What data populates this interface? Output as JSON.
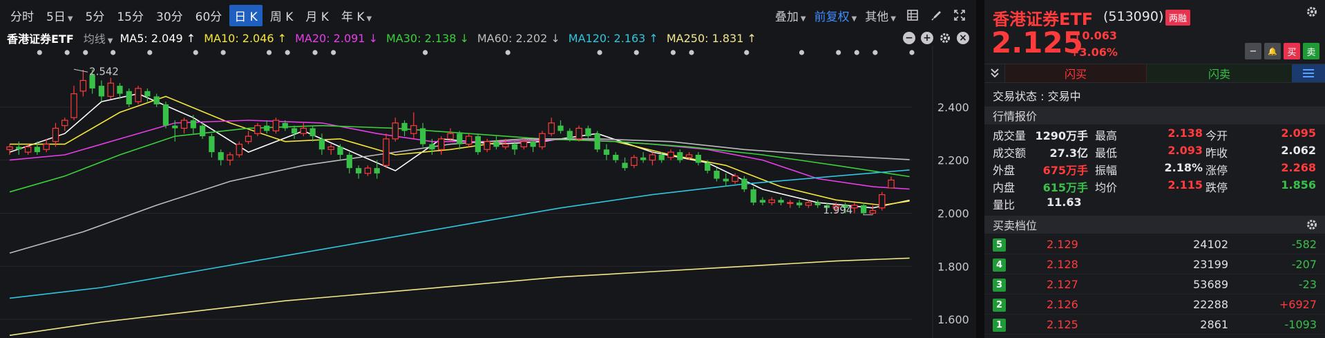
{
  "toolbar": {
    "periods": [
      "分时",
      "5日",
      "5分",
      "15分",
      "30分",
      "60分",
      "日 K",
      "周 K",
      "月 K",
      "年 K"
    ],
    "active_period": "日 K",
    "overlay_label": "叠加",
    "adjust_label": "前复权",
    "other_label": "其他"
  },
  "ma_row": {
    "name": "香港证券ETF",
    "mode": "均线",
    "items": [
      {
        "text": "MA5: 2.049 ↑",
        "color": "#ffffff"
      },
      {
        "text": "MA10: 2.046 ↑",
        "color": "#f5e63a"
      },
      {
        "text": "MA20: 2.091 ↓",
        "color": "#e83ee8"
      },
      {
        "text": "MA30: 2.138 ↓",
        "color": "#3ad13a"
      },
      {
        "text": "MA60: 2.202 ↓",
        "color": "#bdbdbd"
      },
      {
        "text": "MA120: 2.163 ↑",
        "color": "#2fc6e0"
      },
      {
        "text": "MA250: 1.831 ↑",
        "color": "#f2e68a"
      }
    ],
    "minus": "−",
    "plus": "+",
    "close": "×"
  },
  "chart_data": {
    "type": "candlestick",
    "y_ticks": [
      "2.400",
      "2.200",
      "2.000",
      "1.800",
      "1.600"
    ],
    "ylim": [
      1.53,
      2.6
    ],
    "annotations": [
      {
        "text": "2.542",
        "value": 2.542,
        "index": 7
      },
      {
        "text": "1.994",
        "value": 1.994,
        "index": 94
      }
    ],
    "candles": [
      [
        2.24,
        2.25,
        2.26,
        2.22
      ],
      [
        2.25,
        2.24,
        2.27,
        2.22
      ],
      [
        2.23,
        2.25,
        2.26,
        2.22
      ],
      [
        2.25,
        2.23,
        2.27,
        2.22
      ],
      [
        2.24,
        2.26,
        2.28,
        2.23
      ],
      [
        2.27,
        2.32,
        2.34,
        2.25
      ],
      [
        2.33,
        2.35,
        2.36,
        2.31
      ],
      [
        2.36,
        2.45,
        2.48,
        2.35
      ],
      [
        2.46,
        2.5,
        2.54,
        2.44
      ],
      [
        2.52,
        2.47,
        2.542,
        2.45
      ],
      [
        2.48,
        2.44,
        2.5,
        2.42
      ],
      [
        2.44,
        2.49,
        2.51,
        2.43
      ],
      [
        2.48,
        2.45,
        2.49,
        2.43
      ],
      [
        2.46,
        2.41,
        2.47,
        2.4
      ],
      [
        2.42,
        2.47,
        2.48,
        2.41
      ],
      [
        2.46,
        2.44,
        2.47,
        2.42
      ],
      [
        2.44,
        2.41,
        2.45,
        2.4
      ],
      [
        2.41,
        2.33,
        2.42,
        2.32
      ],
      [
        2.33,
        2.32,
        2.35,
        2.27
      ],
      [
        2.32,
        2.35,
        2.36,
        2.3
      ],
      [
        2.35,
        2.32,
        2.37,
        2.3
      ],
      [
        2.33,
        2.29,
        2.34,
        2.28
      ],
      [
        2.29,
        2.23,
        2.3,
        2.21
      ],
      [
        2.23,
        2.2,
        2.24,
        2.18
      ],
      [
        2.2,
        2.22,
        2.23,
        2.18
      ],
      [
        2.22,
        2.26,
        2.27,
        2.21
      ],
      [
        2.27,
        2.29,
        2.31,
        2.26
      ],
      [
        2.3,
        2.33,
        2.34,
        2.29
      ],
      [
        2.33,
        2.31,
        2.35,
        2.3
      ],
      [
        2.31,
        2.35,
        2.36,
        2.3
      ],
      [
        2.34,
        2.32,
        2.35,
        2.31
      ],
      [
        2.32,
        2.3,
        2.33,
        2.28
      ],
      [
        2.3,
        2.32,
        2.34,
        2.29
      ],
      [
        2.32,
        2.29,
        2.33,
        2.27
      ],
      [
        2.28,
        2.24,
        2.3,
        2.22
      ],
      [
        2.24,
        2.25,
        2.26,
        2.22
      ],
      [
        2.25,
        2.22,
        2.26,
        2.2
      ],
      [
        2.22,
        2.17,
        2.23,
        2.15
      ],
      [
        2.17,
        2.15,
        2.18,
        2.13
      ],
      [
        2.15,
        2.17,
        2.18,
        2.14
      ],
      [
        2.17,
        2.15,
        2.2,
        2.13
      ],
      [
        2.18,
        2.28,
        2.3,
        2.17
      ],
      [
        2.28,
        2.34,
        2.36,
        2.27
      ],
      [
        2.34,
        2.31,
        2.35,
        2.29
      ],
      [
        2.3,
        2.33,
        2.38,
        2.28
      ],
      [
        2.32,
        2.26,
        2.34,
        2.25
      ],
      [
        2.26,
        2.24,
        2.28,
        2.22
      ],
      [
        2.24,
        2.28,
        2.29,
        2.22
      ],
      [
        2.28,
        2.3,
        2.32,
        2.27
      ],
      [
        2.3,
        2.26,
        2.31,
        2.24
      ],
      [
        2.26,
        2.29,
        2.3,
        2.25
      ],
      [
        2.29,
        2.23,
        2.3,
        2.22
      ],
      [
        2.24,
        2.27,
        2.28,
        2.23
      ],
      [
        2.27,
        2.25,
        2.29,
        2.24
      ],
      [
        2.25,
        2.26,
        2.28,
        2.24
      ],
      [
        2.26,
        2.24,
        2.27,
        2.22
      ],
      [
        2.25,
        2.27,
        2.28,
        2.24
      ],
      [
        2.27,
        2.25,
        2.28,
        2.23
      ],
      [
        2.25,
        2.3,
        2.31,
        2.24
      ],
      [
        2.3,
        2.34,
        2.36,
        2.29
      ],
      [
        2.33,
        2.31,
        2.35,
        2.3
      ],
      [
        2.31,
        2.28,
        2.32,
        2.27
      ],
      [
        2.28,
        2.32,
        2.33,
        2.27
      ],
      [
        2.32,
        2.29,
        2.33,
        2.28
      ],
      [
        2.3,
        2.24,
        2.31,
        2.23
      ],
      [
        2.24,
        2.22,
        2.26,
        2.2
      ],
      [
        2.22,
        2.2,
        2.23,
        2.19
      ],
      [
        2.19,
        2.17,
        2.21,
        2.16
      ],
      [
        2.18,
        2.21,
        2.22,
        2.17
      ],
      [
        2.21,
        2.2,
        2.23,
        2.19
      ],
      [
        2.2,
        2.22,
        2.23,
        2.18
      ],
      [
        2.22,
        2.2,
        2.23,
        2.19
      ],
      [
        2.21,
        2.23,
        2.24,
        2.2
      ],
      [
        2.23,
        2.2,
        2.24,
        2.19
      ],
      [
        2.21,
        2.22,
        2.23,
        2.2
      ],
      [
        2.22,
        2.19,
        2.23,
        2.18
      ],
      [
        2.19,
        2.16,
        2.2,
        2.15
      ],
      [
        2.16,
        2.13,
        2.17,
        2.12
      ],
      [
        2.13,
        2.12,
        2.15,
        2.1
      ],
      [
        2.12,
        2.14,
        2.15,
        2.11
      ],
      [
        2.13,
        2.09,
        2.14,
        2.08
      ],
      [
        2.09,
        2.04,
        2.1,
        2.03
      ],
      [
        2.05,
        2.04,
        2.06,
        2.03
      ],
      [
        2.04,
        2.05,
        2.06,
        2.03
      ],
      [
        2.05,
        2.04,
        2.06,
        2.03
      ],
      [
        2.04,
        2.04,
        2.05,
        2.02
      ],
      [
        2.04,
        2.03,
        2.05,
        2.02
      ],
      [
        2.03,
        2.04,
        2.05,
        2.02
      ],
      [
        2.04,
        2.03,
        2.05,
        2.02
      ],
      [
        2.03,
        2.02,
        2.04,
        2.01
      ],
      [
        2.02,
        2.03,
        2.04,
        2.0
      ],
      [
        2.03,
        2.02,
        2.04,
        2.0
      ],
      [
        2.02,
        2.03,
        2.04,
        2.0
      ],
      [
        2.03,
        2.0,
        2.04,
        1.994
      ],
      [
        2.0,
        2.01,
        2.03,
        1.995
      ],
      [
        2.02,
        2.07,
        2.08,
        2.01
      ],
      [
        2.095,
        2.125,
        2.138,
        2.093
      ]
    ],
    "ma_lines": [
      {
        "name": "MA5",
        "color": "#ffffff",
        "values_start": 2.23,
        "points": [
          [
            0,
            2.23
          ],
          [
            6,
            2.3
          ],
          [
            10,
            2.42
          ],
          [
            14,
            2.45
          ],
          [
            20,
            2.36
          ],
          [
            26,
            2.23
          ],
          [
            32,
            2.31
          ],
          [
            38,
            2.22
          ],
          [
            42,
            2.16
          ],
          [
            47,
            2.28
          ],
          [
            53,
            2.26
          ],
          [
            58,
            2.27
          ],
          [
            64,
            2.3
          ],
          [
            70,
            2.23
          ],
          [
            76,
            2.19
          ],
          [
            82,
            2.09
          ],
          [
            88,
            2.04
          ],
          [
            94,
            2.02
          ],
          [
            98,
            2.049
          ]
        ]
      },
      {
        "name": "MA10",
        "color": "#f5e63a",
        "points": [
          [
            0,
            2.26
          ],
          [
            6,
            2.26
          ],
          [
            12,
            2.38
          ],
          [
            17,
            2.44
          ],
          [
            24,
            2.34
          ],
          [
            30,
            2.27
          ],
          [
            36,
            2.28
          ],
          [
            42,
            2.22
          ],
          [
            48,
            2.24
          ],
          [
            54,
            2.27
          ],
          [
            60,
            2.28
          ],
          [
            66,
            2.27
          ],
          [
            72,
            2.22
          ],
          [
            78,
            2.18
          ],
          [
            84,
            2.1
          ],
          [
            90,
            2.05
          ],
          [
            95,
            2.03
          ],
          [
            98,
            2.046
          ]
        ]
      },
      {
        "name": "MA20",
        "color": "#e83ee8",
        "points": [
          [
            0,
            2.2
          ],
          [
            6,
            2.22
          ],
          [
            12,
            2.28
          ],
          [
            18,
            2.34
          ],
          [
            26,
            2.35
          ],
          [
            34,
            2.34
          ],
          [
            40,
            2.3
          ],
          [
            46,
            2.27
          ],
          [
            54,
            2.27
          ],
          [
            62,
            2.28
          ],
          [
            70,
            2.26
          ],
          [
            76,
            2.24
          ],
          [
            82,
            2.2
          ],
          [
            88,
            2.13
          ],
          [
            94,
            2.1
          ],
          [
            98,
            2.091
          ]
        ]
      },
      {
        "name": "MA30",
        "color": "#3ad13a",
        "points": [
          [
            0,
            2.08
          ],
          [
            6,
            2.14
          ],
          [
            12,
            2.22
          ],
          [
            18,
            2.29
          ],
          [
            26,
            2.32
          ],
          [
            34,
            2.33
          ],
          [
            42,
            2.32
          ],
          [
            50,
            2.3
          ],
          [
            58,
            2.28
          ],
          [
            66,
            2.27
          ],
          [
            74,
            2.25
          ],
          [
            82,
            2.22
          ],
          [
            90,
            2.18
          ],
          [
            98,
            2.138
          ]
        ]
      },
      {
        "name": "MA60",
        "color": "#bdbdbd",
        "points": [
          [
            0,
            1.85
          ],
          [
            8,
            1.93
          ],
          [
            16,
            2.03
          ],
          [
            24,
            2.12
          ],
          [
            32,
            2.18
          ],
          [
            40,
            2.22
          ],
          [
            48,
            2.26
          ],
          [
            56,
            2.28
          ],
          [
            64,
            2.28
          ],
          [
            72,
            2.27
          ],
          [
            80,
            2.24
          ],
          [
            88,
            2.22
          ],
          [
            98,
            2.202
          ]
        ]
      },
      {
        "name": "MA120",
        "color": "#2fc6e0",
        "points": [
          [
            0,
            1.68
          ],
          [
            10,
            1.72
          ],
          [
            20,
            1.78
          ],
          [
            30,
            1.84
          ],
          [
            40,
            1.9
          ],
          [
            50,
            1.96
          ],
          [
            60,
            2.02
          ],
          [
            70,
            2.07
          ],
          [
            80,
            2.11
          ],
          [
            90,
            2.14
          ],
          [
            98,
            2.163
          ]
        ]
      },
      {
        "name": "MA250",
        "color": "#f2e68a",
        "points": [
          [
            0,
            1.54
          ],
          [
            10,
            1.59
          ],
          [
            20,
            1.63
          ],
          [
            30,
            1.67
          ],
          [
            40,
            1.7
          ],
          [
            50,
            1.73
          ],
          [
            60,
            1.76
          ],
          [
            70,
            1.78
          ],
          [
            80,
            1.8
          ],
          [
            90,
            1.82
          ],
          [
            98,
            1.831
          ]
        ]
      }
    ],
    "event_markers": [
      1,
      4,
      6,
      9,
      13,
      18,
      21,
      26,
      28,
      31,
      33,
      43,
      52,
      62,
      66,
      70,
      72,
      78,
      84,
      88,
      90,
      92,
      96,
      100
    ]
  },
  "stock": {
    "name": "香港证券ETF",
    "code": "(513090)",
    "tag": "两融",
    "price": "2.125",
    "change_abs": "↑0.063",
    "change_pct": "+3.06%",
    "btn_minus": "−",
    "btn_bell": "🔔",
    "btn_buy": "买",
    "btn_sell": "卖"
  },
  "trade_bar": {
    "expand": "≡",
    "flash_buy": "闪买",
    "flash_sell": "闪卖"
  },
  "status": {
    "text": "交易状态 : 交易中"
  },
  "quote": {
    "title": "行情报价",
    "rows": [
      [
        {
          "l": "成交量",
          "v": "1290万手",
          "c": "white"
        },
        {
          "l": "最高",
          "v": "2.138",
          "c": "red"
        },
        {
          "l": "今开",
          "v": "2.095",
          "c": "red"
        }
      ],
      [
        {
          "l": "成交额",
          "v": "27.3亿",
          "c": "white"
        },
        {
          "l": "最低",
          "v": "2.093",
          "c": "red"
        },
        {
          "l": "昨收",
          "v": "2.062",
          "c": "white"
        }
      ],
      [
        {
          "l": "外盘",
          "v": "675万手",
          "c": "red"
        },
        {
          "l": "振幅",
          "v": "2.18%",
          "c": "white"
        },
        {
          "l": "涨停",
          "v": "2.268",
          "c": "red"
        }
      ],
      [
        {
          "l": "内盘",
          "v": "615万手",
          "c": "green"
        },
        {
          "l": "均价",
          "v": "2.115",
          "c": "red"
        },
        {
          "l": "跌停",
          "v": "1.856",
          "c": "green"
        }
      ],
      [
        {
          "l": "量比",
          "v": "11.63",
          "c": "white"
        }
      ]
    ]
  },
  "orderbook": {
    "title": "买卖档位",
    "rows": [
      {
        "level": "5",
        "price": "2.129",
        "vol": "24102",
        "chg": "-582",
        "chg_color": "green"
      },
      {
        "level": "4",
        "price": "2.128",
        "vol": "23199",
        "chg": "-207",
        "chg_color": "green"
      },
      {
        "level": "3",
        "price": "2.127",
        "vol": "53689",
        "chg": "-23",
        "chg_color": "green"
      },
      {
        "level": "2",
        "price": "2.126",
        "vol": "22288",
        "chg": "+6927",
        "chg_color": "red"
      },
      {
        "level": "1",
        "price": "2.125",
        "vol": "2861",
        "chg": "-1093",
        "chg_color": "green"
      }
    ]
  },
  "colors": {
    "up": "#ff3b3b",
    "down": "#39c049",
    "accent": "#1f5fbf"
  }
}
